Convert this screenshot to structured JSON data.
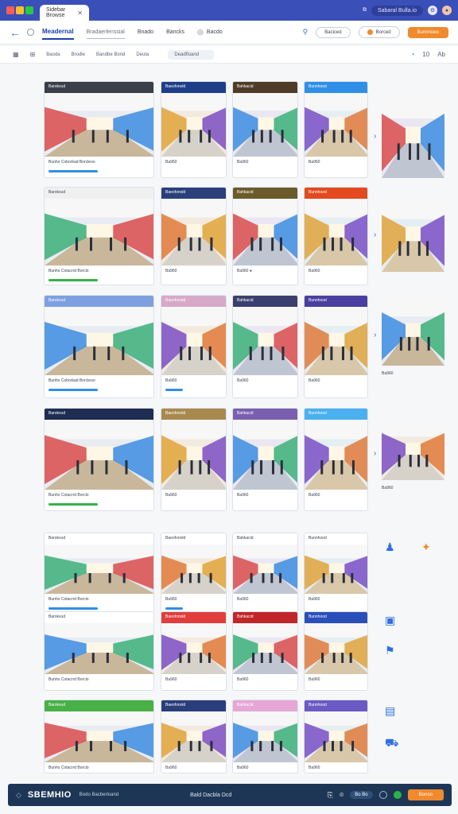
{
  "browser": {
    "tab_label": "Sidebar Browse",
    "window_pill": "Sabaral Bulla.io"
  },
  "header": {
    "nav": [
      "Meadernal",
      "Bradaerlenssial",
      "Bnado",
      "Bancks",
      "Bacdo"
    ],
    "outline_button": "Baciced",
    "accent_button": "Borced",
    "primary_button": "Bunnnoeo"
  },
  "toolbar": {
    "items": [
      "Baoda",
      "Brodle",
      "Bandbe Bond",
      "Deuta"
    ],
    "filter": "Deadfloand",
    "right_icons": [
      "10",
      "Ab"
    ]
  },
  "colors": {
    "brand_blue": "#3b4fb8",
    "accent_orange": "#f08a2c",
    "footer_navy": "#1d3656",
    "progress_blue": "#2f8fe6",
    "progress_green": "#34b24a"
  },
  "cards": [
    {
      "cap": "Barokvud",
      "meta": "Bunho Coborkad Borcleoo",
      "bar": "progress_blue"
    },
    {
      "cap": "Baeofonold",
      "meta": "Ba960",
      "bar": null
    },
    {
      "cap": "Bahkacid",
      "meta": "Ba960",
      "bar": null
    },
    {
      "cap": "Bunnhood",
      "meta": "Ba960",
      "bar": null
    },
    {
      "cap": "Barokvud",
      "meta": "Bunho Cotacrrd Borclo",
      "bar": "progress_green"
    },
    {
      "cap": "Baeofonold",
      "meta": "Ba960",
      "bar": null
    },
    {
      "cap": "Bahkacid",
      "meta": "Ba960 ●",
      "bar": null
    },
    {
      "cap": "Bunnhood",
      "meta": "Ba960",
      "bar": null
    },
    {
      "cap": "Barokvud",
      "meta": "Bunho Coborkad Borcleoo",
      "bar": "progress_blue"
    },
    {
      "cap": "Baeofonold",
      "meta": "Ba960",
      "bar": "progress_blue"
    },
    {
      "cap": "Bahkacid",
      "meta": "Ba960",
      "bar": null
    },
    {
      "cap": "Bunnhood",
      "meta": "Ba960",
      "bar": null
    },
    {
      "cap": "Barokvud",
      "meta": "Bunho Cotacrrd Borclo",
      "bar": "progress_green"
    },
    {
      "cap": "Baeofonold",
      "meta": "Ba960",
      "bar": null
    },
    {
      "cap": "Bahkacid",
      "meta": "Ba960",
      "bar": null
    },
    {
      "cap": "Bunnhood",
      "meta": "Ba960",
      "bar": null
    },
    {
      "cap": "Barokvud",
      "meta": "Bunho Cotacrrd Borclo",
      "bar": "progress_blue"
    },
    {
      "cap": "Baeofonold",
      "meta": "Ba960",
      "bar": "progress_blue"
    },
    {
      "cap": "Bahkacid",
      "meta": "Ba960",
      "bar": null
    },
    {
      "cap": "Bunnhood",
      "meta": "Ba960",
      "bar": null
    },
    {
      "cap": "Barokvud",
      "meta": "Bunho Cotacrrd Borclo",
      "bar": null
    },
    {
      "cap": "Baeofonold",
      "meta": "Ba960",
      "bar": null
    },
    {
      "cap": "Bahkacid",
      "meta": "Ba960",
      "bar": null
    },
    {
      "cap": "Bunnhood",
      "meta": "Ba960",
      "bar": null
    },
    {
      "cap": "Barokvud",
      "meta": "Bunho Cotacrrd Borclo",
      "bar": "progress_blue"
    },
    {
      "cap": "Baeofonold",
      "meta": "Ba960",
      "bar": null
    },
    {
      "cap": "Bahkacid",
      "meta": "Ba960",
      "bar": null
    },
    {
      "cap": "Bunnhood",
      "meta": "Ba960",
      "bar": null
    }
  ],
  "side_previews": [
    {
      "label": ""
    },
    {
      "label": ""
    },
    {
      "label": "Ba960"
    },
    {
      "label": "Ba960"
    }
  ],
  "footer": {
    "logo": "SBEMHIO",
    "sub": "Bodo Bacberloand",
    "center": "Bald Dacbla Dcd",
    "chip": "Bo Bo",
    "cta": "Bonoo"
  }
}
